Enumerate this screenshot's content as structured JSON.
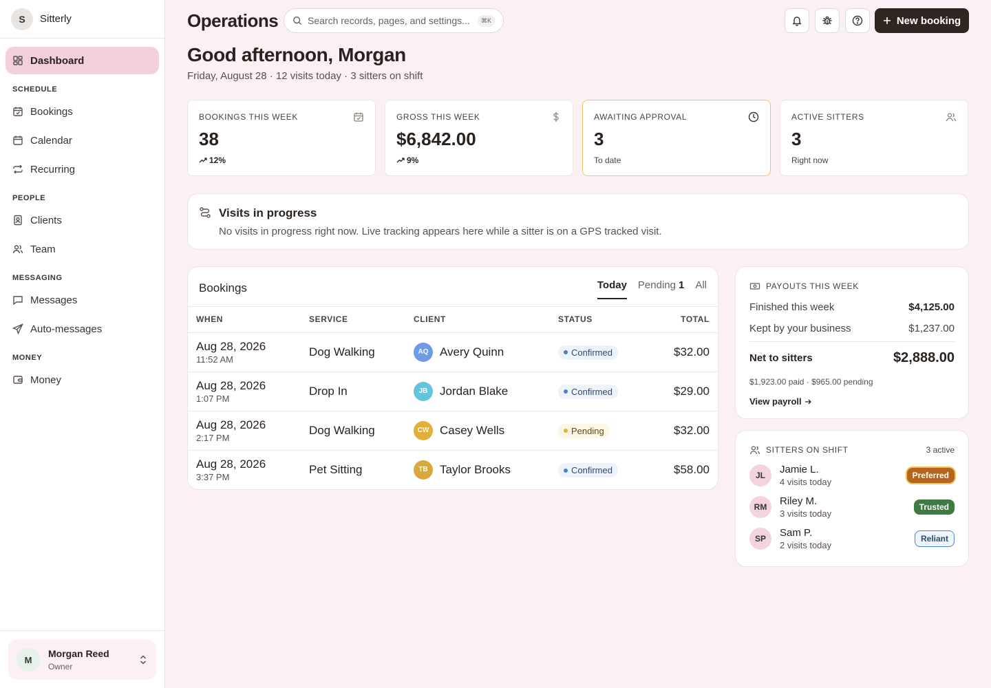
{
  "brand": {
    "initial": "S",
    "name": "Sitterly"
  },
  "nav": {
    "dashboard": "Dashboard",
    "sections": {
      "schedule": "SCHEDULE",
      "people": "PEOPLE",
      "messaging": "MESSAGING",
      "money": "MONEY"
    },
    "bookings": "Bookings",
    "calendar": "Calendar",
    "recurring": "Recurring",
    "clients": "Clients",
    "team": "Team",
    "messages": "Messages",
    "auto_messages": "Auto-messages",
    "money": "Money"
  },
  "user": {
    "initial": "M",
    "name": "Morgan Reed",
    "role": "Owner"
  },
  "header": {
    "title": "Operations",
    "search_placeholder": "Search records, pages, and settings...",
    "search_shortcut": "⌘K",
    "new_booking": "New booking"
  },
  "greeting": "Good afternoon, Morgan",
  "subline": "Friday, August 28 · 12 visits today · 3 sitters on shift",
  "stats": [
    {
      "label": "BOOKINGS THIS WEEK",
      "value": "38",
      "foot": "12%",
      "icon": "calendar-check-icon"
    },
    {
      "label": "GROSS THIS WEEK",
      "value": "$6,842.00",
      "foot": "9%",
      "icon": "dollar-icon"
    },
    {
      "label": "AWAITING APPROVAL",
      "value": "3",
      "foot": "To date",
      "icon": "clock-icon"
    },
    {
      "label": "ACTIVE SITTERS",
      "value": "3",
      "foot": "Right now",
      "icon": "users-icon"
    }
  ],
  "visits": {
    "title": "Visits in progress",
    "text": "No visits in progress right now. Live tracking appears here while a sitter is on a GPS tracked visit."
  },
  "bookings": {
    "title": "Bookings",
    "tabs": {
      "today": "Today",
      "pending": "Pending",
      "pending_count": "1",
      "all": "All"
    },
    "columns": {
      "when": "WHEN",
      "service": "SERVICE",
      "client": "CLIENT",
      "status": "STATUS",
      "total": "TOTAL"
    },
    "rows": [
      {
        "date": "Aug 28, 2026",
        "time": "11:52 AM",
        "service": "Dog Walking",
        "initials": "AQ",
        "client": "Avery Quinn",
        "avatar_color": "#6f9be4",
        "status": "Confirmed",
        "status_kind": "confirmed",
        "total": "$32.00"
      },
      {
        "date": "Aug 28, 2026",
        "time": "1:07 PM",
        "service": "Drop In",
        "initials": "JB",
        "client": "Jordan Blake",
        "avatar_color": "#62c4de",
        "status": "Confirmed",
        "status_kind": "confirmed",
        "total": "$29.00"
      },
      {
        "date": "Aug 28, 2026",
        "time": "2:17 PM",
        "service": "Dog Walking",
        "initials": "CW",
        "client": "Casey Wells",
        "avatar_color": "#e0b03a",
        "status": "Pending",
        "status_kind": "pending",
        "total": "$32.00"
      },
      {
        "date": "Aug 28, 2026",
        "time": "3:37 PM",
        "service": "Pet Sitting",
        "initials": "TB",
        "client": "Taylor Brooks",
        "avatar_color": "#d9a83a",
        "status": "Confirmed",
        "status_kind": "confirmed",
        "total": "$58.00"
      }
    ]
  },
  "payouts": {
    "title": "PAYOUTS THIS WEEK",
    "finished_label": "Finished this week",
    "finished_value": "$4,125.00",
    "kept_label": "Kept by your business",
    "kept_value": "$1,237.00",
    "net_label": "Net to sitters",
    "net_value": "$2,888.00",
    "note": "$1,923.00 paid · $965.00 pending",
    "link": "View payroll"
  },
  "sitters": {
    "title": "SITTERS ON SHIFT",
    "count": "3 active",
    "list": [
      {
        "initials": "JL",
        "name": "Jamie L.",
        "visits": "4 visits today",
        "tag": "Preferred",
        "tag_kind": "preferred"
      },
      {
        "initials": "RM",
        "name": "Riley M.",
        "visits": "3 visits today",
        "tag": "Trusted",
        "tag_kind": "trusted"
      },
      {
        "initials": "SP",
        "name": "Sam P.",
        "visits": "2 visits today",
        "tag": "Reliant",
        "tag_kind": "reliant"
      }
    ]
  }
}
